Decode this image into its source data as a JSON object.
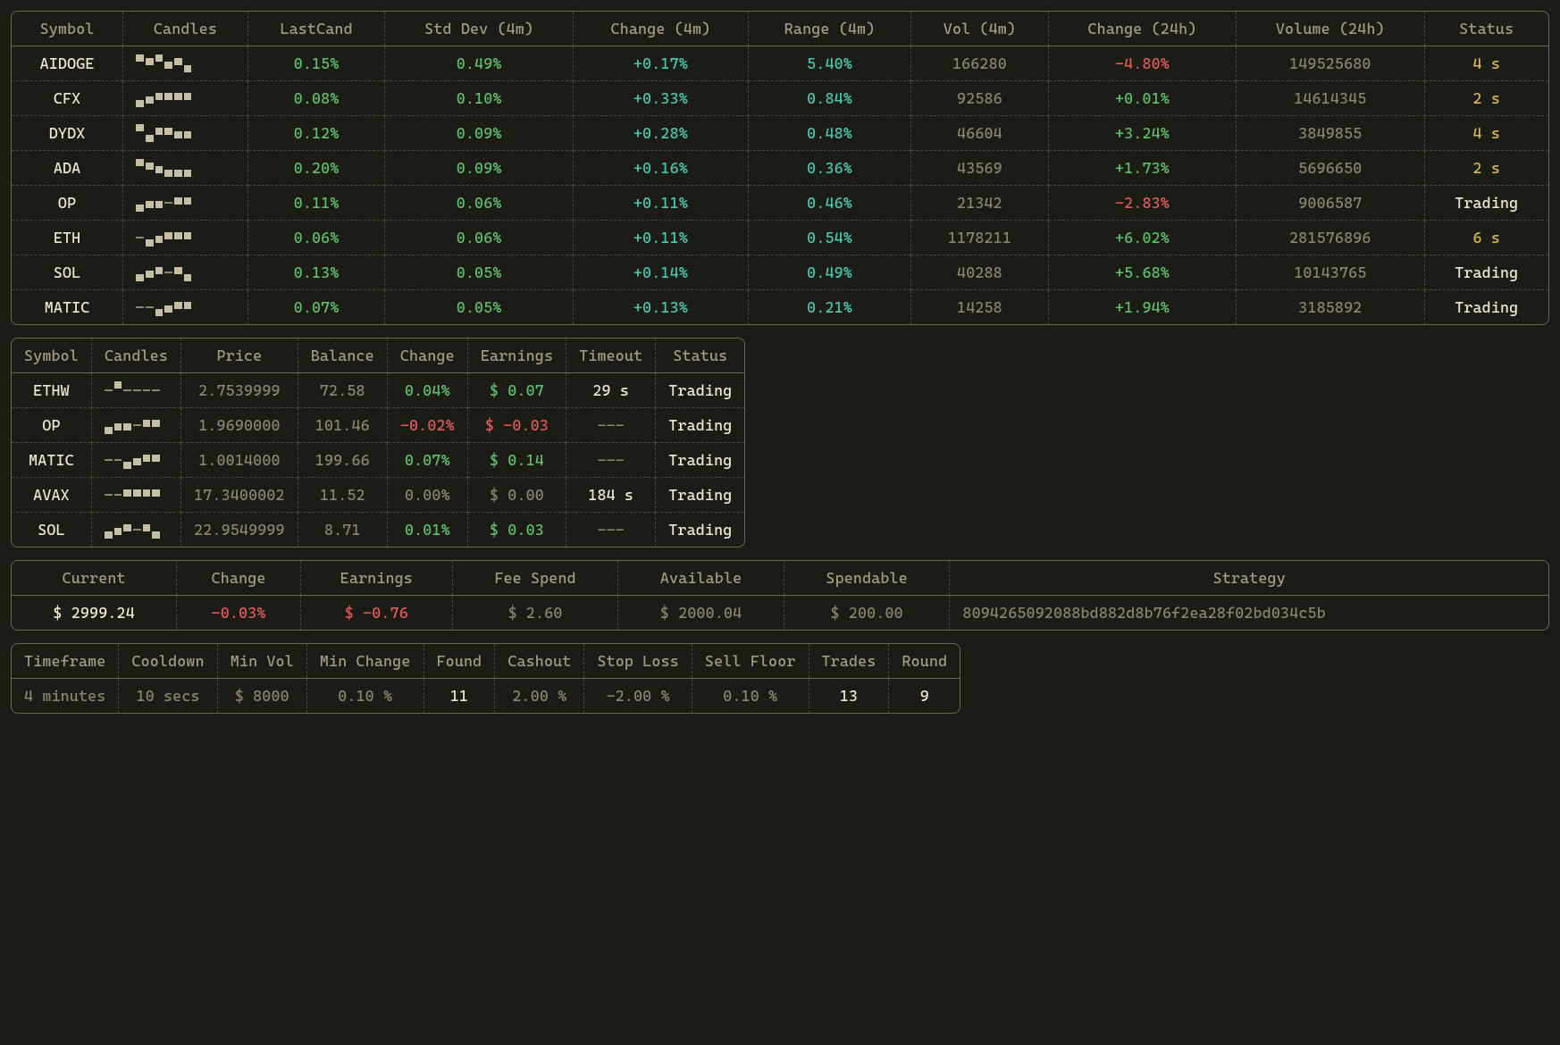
{
  "market": {
    "headers": [
      "Symbol",
      "Candles",
      "LastCand",
      "Std Dev (4m)",
      "Change (4m)",
      "Range (4m)",
      "Vol (4m)",
      "Change (24h)",
      "Volume (24h)",
      "Status"
    ],
    "rows": [
      {
        "symbol": "AIDOGE",
        "candles": [
          3,
          2,
          3,
          1,
          2,
          0
        ],
        "lastCand": "0.15%",
        "stdDev": "0.49%",
        "change4m": "+0.17%",
        "range4m": "5.40%",
        "vol4m": "166280",
        "change24h": "-4.80%",
        "ch24class": "c-red",
        "vol24h": "149525680",
        "status": "4 s",
        "statusClass": "c-yellow"
      },
      {
        "symbol": "CFX",
        "candles": [
          0,
          1,
          2,
          2,
          2,
          2
        ],
        "lastCand": "0.08%",
        "stdDev": "0.10%",
        "change4m": "+0.33%",
        "range4m": "0.84%",
        "vol4m": "92586",
        "change24h": "+0.01%",
        "ch24class": "c-green",
        "vol24h": "14614345",
        "status": "2 s",
        "statusClass": "c-yellow"
      },
      {
        "symbol": "DYDX",
        "candles": [
          3,
          0,
          2,
          2,
          1,
          1
        ],
        "lastCand": "0.12%",
        "stdDev": "0.09%",
        "change4m": "+0.28%",
        "range4m": "0.48%",
        "vol4m": "46604",
        "change24h": "+3.24%",
        "ch24class": "c-green",
        "vol24h": "3849855",
        "status": "4 s",
        "statusClass": "c-yellow"
      },
      {
        "symbol": "ADA",
        "candles": [
          3,
          2,
          1,
          0,
          0,
          0
        ],
        "lastCand": "0.20%",
        "stdDev": "0.09%",
        "change4m": "+0.16%",
        "range4m": "0.36%",
        "vol4m": "43569",
        "change24h": "+1.73%",
        "ch24class": "c-green",
        "vol24h": "5696650",
        "status": "2 s",
        "statusClass": "c-yellow"
      },
      {
        "symbol": "OP",
        "candles": [
          0,
          1,
          1,
          -1,
          2,
          2
        ],
        "lastCand": "0.11%",
        "stdDev": "0.06%",
        "change4m": "+0.11%",
        "range4m": "0.46%",
        "vol4m": "21342",
        "change24h": "-2.83%",
        "ch24class": "c-red",
        "vol24h": "9006587",
        "status": "Trading",
        "statusClass": "c-white"
      },
      {
        "symbol": "ETH",
        "candles": [
          -1,
          0,
          1,
          2,
          2,
          2
        ],
        "lastCand": "0.06%",
        "stdDev": "0.06%",
        "change4m": "+0.11%",
        "range4m": "0.54%",
        "vol4m": "1178211",
        "change24h": "+6.02%",
        "ch24class": "c-green",
        "vol24h": "281576896",
        "status": "6 s",
        "statusClass": "c-yellow"
      },
      {
        "symbol": "SOL",
        "candles": [
          0,
          1,
          2,
          -1,
          2,
          0
        ],
        "lastCand": "0.13%",
        "stdDev": "0.05%",
        "change4m": "+0.14%",
        "range4m": "0.49%",
        "vol4m": "40288",
        "change24h": "+5.68%",
        "ch24class": "c-green",
        "vol24h": "10143765",
        "status": "Trading",
        "statusClass": "c-white"
      },
      {
        "symbol": "MATIC",
        "candles": [
          -1,
          -1,
          0,
          1,
          2,
          2
        ],
        "lastCand": "0.07%",
        "stdDev": "0.05%",
        "change4m": "+0.13%",
        "range4m": "0.21%",
        "vol4m": "14258",
        "change24h": "+1.94%",
        "ch24class": "c-green",
        "vol24h": "3185892",
        "status": "Trading",
        "statusClass": "c-white"
      }
    ]
  },
  "positions": {
    "headers": [
      "Symbol",
      "Candles",
      "Price",
      "Balance",
      "Change",
      "Earnings",
      "Timeout",
      "Status"
    ],
    "rows": [
      {
        "symbol": "ETHW",
        "candles": [
          -1,
          3,
          -1,
          -1,
          -1,
          -1
        ],
        "price": "2.7539999",
        "balance": "72.58",
        "change": "0.04%",
        "chClass": "c-green",
        "earnings": "$ 0.07",
        "earnClass": "c-green",
        "timeout": "29 s",
        "toClass": "c-white",
        "status": "Trading"
      },
      {
        "symbol": "OP",
        "candles": [
          0,
          1,
          1,
          -1,
          2,
          2
        ],
        "price": "1.9690000",
        "balance": "101.46",
        "change": "-0.02%",
        "chClass": "c-red",
        "earnings": "$ -0.03",
        "earnClass": "c-red",
        "timeout": "---",
        "toClass": "c-gray",
        "status": "Trading"
      },
      {
        "symbol": "MATIC",
        "candles": [
          -1,
          -1,
          0,
          1,
          2,
          2
        ],
        "price": "1.0014000",
        "balance": "199.66",
        "change": "0.07%",
        "chClass": "c-green",
        "earnings": "$ 0.14",
        "earnClass": "c-green",
        "timeout": "---",
        "toClass": "c-gray",
        "status": "Trading"
      },
      {
        "symbol": "AVAX",
        "candles": [
          -1,
          -1,
          2,
          2,
          2,
          2
        ],
        "price": "17.3400002",
        "balance": "11.52",
        "change": "0.00%",
        "chClass": "c-gray",
        "earnings": "$ 0.00",
        "earnClass": "c-gray",
        "timeout": "184 s",
        "toClass": "c-white",
        "status": "Trading"
      },
      {
        "symbol": "SOL",
        "candles": [
          0,
          1,
          2,
          -1,
          2,
          0
        ],
        "price": "22.9549999",
        "balance": "8.71",
        "change": "0.01%",
        "chClass": "c-green",
        "earnings": "$ 0.03",
        "earnClass": "c-green",
        "timeout": "---",
        "toClass": "c-gray",
        "status": "Trading"
      }
    ]
  },
  "summary": {
    "headers": [
      "Current",
      "Change",
      "Earnings",
      "Fee Spend",
      "Available",
      "Spendable",
      "Strategy"
    ],
    "row": {
      "current": "$ 2999.24",
      "change": "-0.03%",
      "earnings": "$ -0.76",
      "feeSpend": "$ 2.60",
      "available": "$ 2000.04",
      "spendable": "$ 200.00",
      "strategy": "8094265092088bd882d8b76f2ea28f02bd034c5b"
    }
  },
  "config": {
    "headers": [
      "Timeframe",
      "Cooldown",
      "Min Vol",
      "Min Change",
      "Found",
      "Cashout",
      "Stop Loss",
      "Sell Floor",
      "Trades",
      "Round"
    ],
    "row": {
      "timeframe": "4 minutes",
      "cooldown": "10 secs",
      "minVol": "$ 8000",
      "minChange": "0.10 %",
      "found": "11",
      "cashout": "2.00 %",
      "stopLoss": "-2.00 %",
      "sellFloor": "0.10 %",
      "trades": "13",
      "round": "9"
    }
  }
}
